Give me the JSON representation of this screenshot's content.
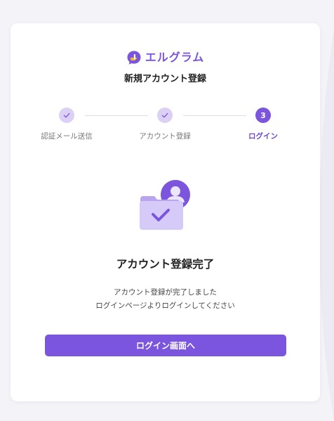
{
  "brand": {
    "name": "エルグラム",
    "logo_icon": "chat-bubble-logo-icon",
    "color": "#7b55de"
  },
  "page": {
    "title": "新規アカウント登録"
  },
  "stepper": {
    "steps": [
      {
        "label": "認証メール送信",
        "state": "done",
        "icon": "check-icon"
      },
      {
        "label": "アカウント登録",
        "state": "done",
        "icon": "check-icon"
      },
      {
        "label": "ログイン",
        "state": "active",
        "number": "3"
      }
    ]
  },
  "illustration": {
    "icon": "user-folder-check-icon"
  },
  "completion": {
    "title": "アカウント登録完了",
    "line1": "アカウント登録が完了しました",
    "line2": "ログインページよりログインしてください"
  },
  "action": {
    "login_label": "ログイン画面へ"
  },
  "colors": {
    "accent": "#7b55de",
    "accent_light": "#dcd1f5",
    "background": "#f4f3f8"
  }
}
